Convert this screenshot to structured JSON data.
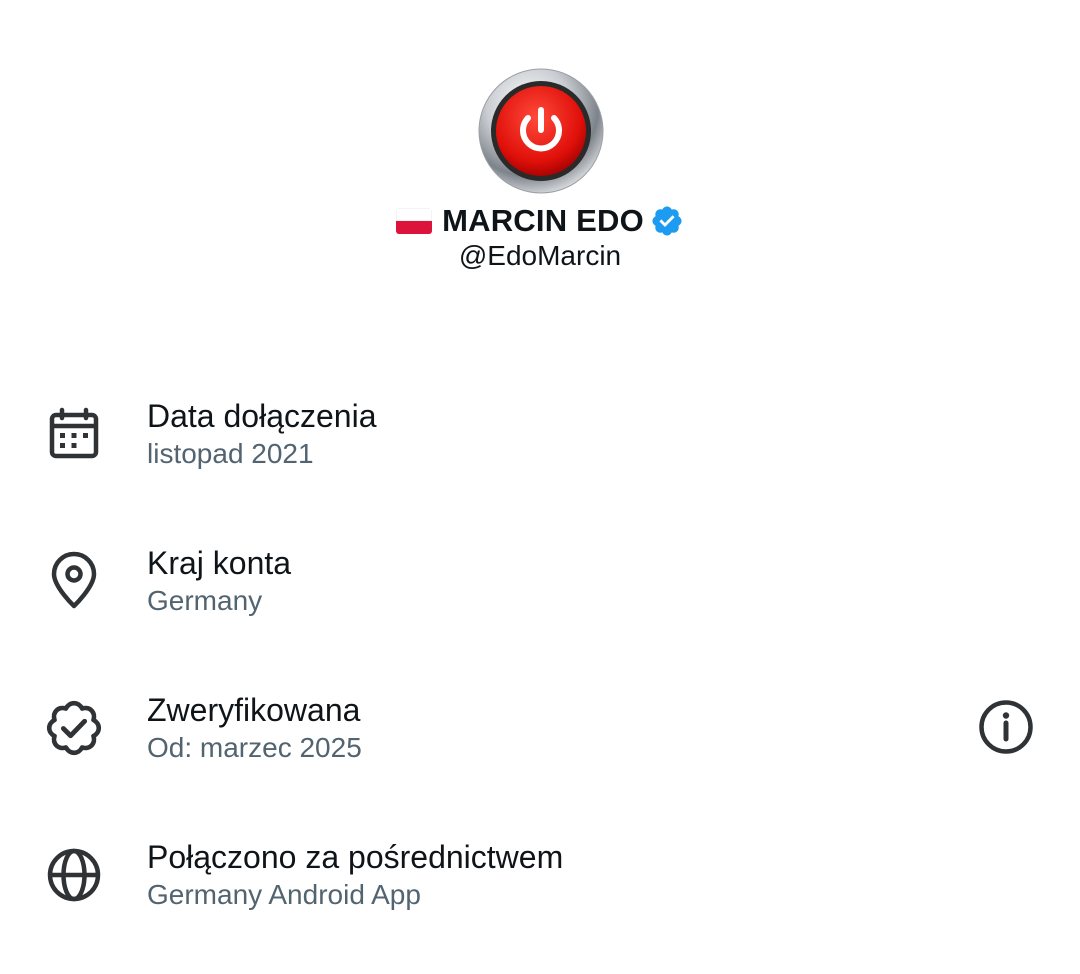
{
  "profile": {
    "flag": "poland-flag",
    "display_name": "MARCIN EDO",
    "handle": "@EdoMarcin",
    "verified_icon": "verified-badge-icon",
    "verified_color": "#1d9bf0"
  },
  "details": [
    {
      "icon": "calendar-icon",
      "label": "Data dołączenia",
      "value": "listopad 2021"
    },
    {
      "icon": "location-pin-icon",
      "label": "Kraj konta",
      "value": "Germany"
    },
    {
      "icon": "verified-check-icon",
      "label": "Zweryfikowana",
      "value": "Od: marzec 2025",
      "info_icon": "info-icon"
    },
    {
      "icon": "globe-icon",
      "label": "Połączono za pośrednictwem",
      "value": "Germany Android App"
    }
  ],
  "colors": {
    "primary_text": "#0f1419",
    "secondary_text": "#536471",
    "icon": "#2f3336"
  }
}
